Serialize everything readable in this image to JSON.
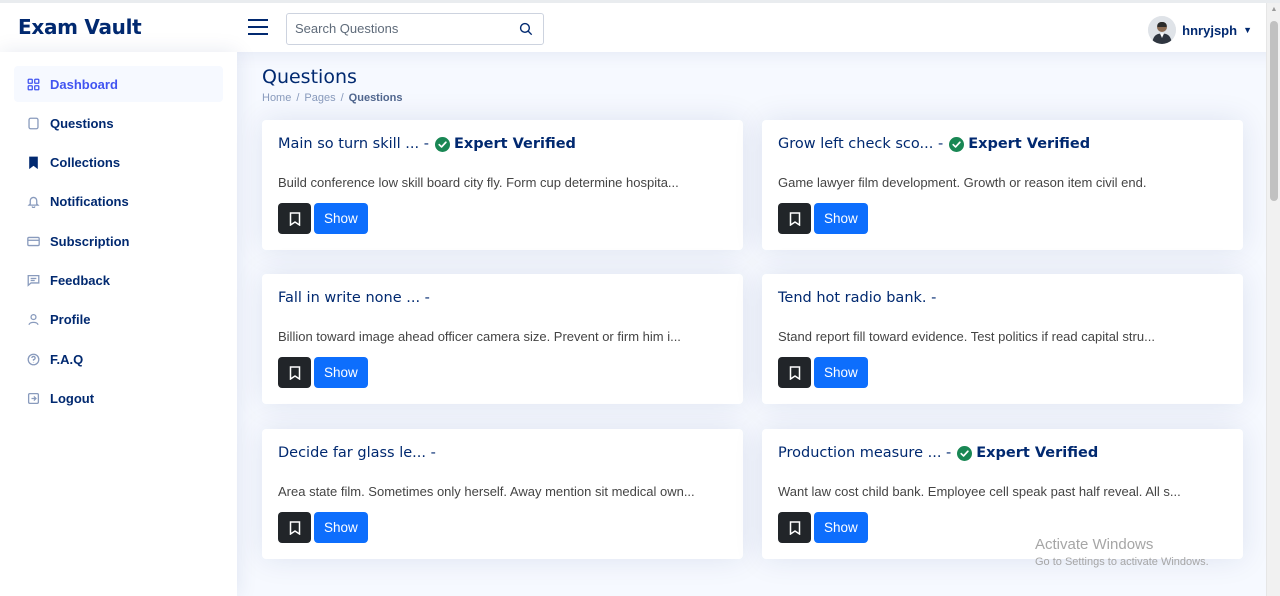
{
  "app": {
    "title": "Exam Vault"
  },
  "search": {
    "placeholder": "Search Questions"
  },
  "user": {
    "name": "hnryjsph"
  },
  "sidebar": {
    "items": [
      {
        "label": "Dashboard",
        "icon": "grid-icon",
        "active": true
      },
      {
        "label": "Questions",
        "icon": "square-icon"
      },
      {
        "label": "Collections",
        "icon": "bookmark-icon"
      },
      {
        "label": "Notifications",
        "icon": "bell-icon"
      },
      {
        "label": "Subscription",
        "icon": "card-icon"
      },
      {
        "label": "Feedback",
        "icon": "message-icon"
      },
      {
        "label": "Profile",
        "icon": "person-icon"
      },
      {
        "label": "F.A.Q",
        "icon": "question-icon"
      },
      {
        "label": "Logout",
        "icon": "logout-icon"
      }
    ]
  },
  "page": {
    "title": "Questions",
    "breadcrumb": [
      "Home",
      "Pages",
      "Questions"
    ]
  },
  "questions": [
    {
      "title": "Main so turn skill ... -",
      "verified": true,
      "verified_label": "Expert Verified",
      "body": "Build conference low skill board city fly. Form cup determine hospita...",
      "show_label": "Show"
    },
    {
      "title": "Grow left check sco... -",
      "verified": true,
      "verified_label": "Expert Verified",
      "body": "Game lawyer film development. Growth or reason item civil end.",
      "show_label": "Show"
    },
    {
      "title": "Fall in write none ... -",
      "verified": false,
      "verified_label": "",
      "body": "Billion toward image ahead officer camera size. Prevent or firm him i...",
      "show_label": "Show"
    },
    {
      "title": "Tend hot radio bank. -",
      "verified": false,
      "verified_label": "",
      "body": "Stand report fill toward evidence. Test politics if read capital stru...",
      "show_label": "Show"
    },
    {
      "title": "Decide far glass le... -",
      "verified": false,
      "verified_label": "",
      "body": "Area state film. Sometimes only herself. Away mention sit medical own...",
      "show_label": "Show"
    },
    {
      "title": "Production measure ... -",
      "verified": true,
      "verified_label": "Expert Verified",
      "body": "Want law cost child bank. Employee cell speak past half reveal. All s...",
      "show_label": "Show"
    }
  ],
  "watermark": {
    "line1": "Activate Windows",
    "line2": "Go to Settings to activate Windows."
  },
  "colors": {
    "brand": "#012970",
    "primary": "#0d6efd",
    "dark": "#212529",
    "verified": "#198754",
    "background": "#f6f9ff"
  }
}
